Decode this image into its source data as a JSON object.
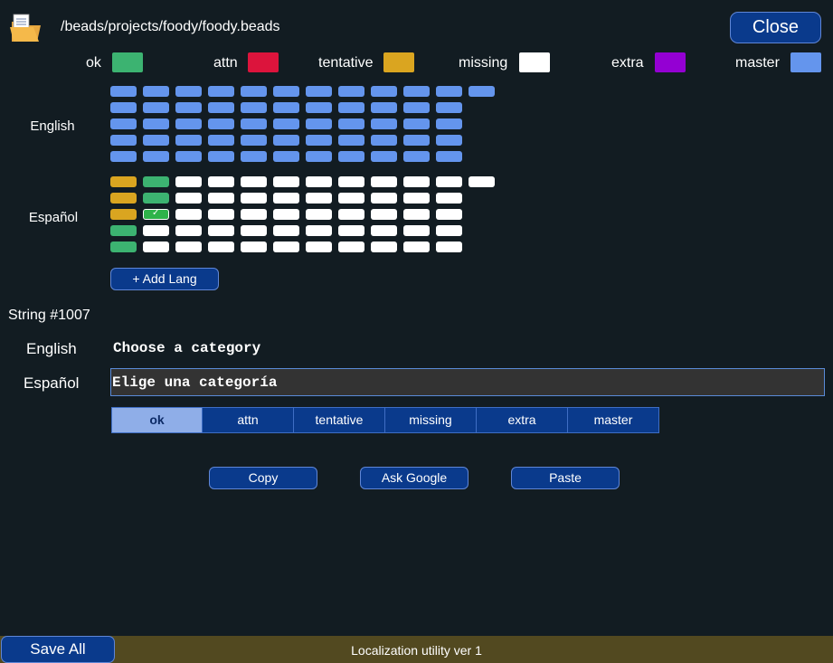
{
  "header": {
    "file_path": "/beads/projects/foody/foody.beads",
    "close_label": "Close",
    "folder_icon": "folder-document-icon"
  },
  "legend": [
    {
      "label": "ok",
      "color": "#3cb371"
    },
    {
      "label": "attn",
      "color": "#dc143c"
    },
    {
      "label": "tentative",
      "color": "#daa520"
    },
    {
      "label": "missing",
      "color": "#ffffff"
    },
    {
      "label": "extra",
      "color": "#9400d3"
    },
    {
      "label": "master",
      "color": "#6495ed"
    }
  ],
  "languages": [
    {
      "name": "English",
      "rows": [
        [
          "master",
          "master",
          "master",
          "master",
          "master",
          "master",
          "master",
          "master",
          "master",
          "master",
          "master",
          "master"
        ],
        [
          "master",
          "master",
          "master",
          "master",
          "master",
          "master",
          "master",
          "master",
          "master",
          "master",
          "master"
        ],
        [
          "master",
          "master",
          "master",
          "master",
          "master",
          "master",
          "master",
          "master",
          "master",
          "master",
          "master"
        ],
        [
          "master",
          "master",
          "master",
          "master",
          "master",
          "master",
          "master",
          "master",
          "master",
          "master",
          "master"
        ],
        [
          "master",
          "master",
          "master",
          "master",
          "master",
          "master",
          "master",
          "master",
          "master",
          "master",
          "master"
        ]
      ]
    },
    {
      "name": "Español",
      "rows": [
        [
          "tentative",
          "ok",
          "missing",
          "missing",
          "missing",
          "missing",
          "missing",
          "missing",
          "missing",
          "missing",
          "missing",
          "missing"
        ],
        [
          "tentative",
          "ok",
          "missing",
          "missing",
          "missing",
          "missing",
          "missing",
          "missing",
          "missing",
          "missing",
          "missing"
        ],
        [
          "tentative",
          "ok-selected",
          "missing",
          "missing",
          "missing",
          "missing",
          "missing",
          "missing",
          "missing",
          "missing",
          "missing"
        ],
        [
          "ok",
          "missing",
          "missing",
          "missing",
          "missing",
          "missing",
          "missing",
          "missing",
          "missing",
          "missing",
          "missing"
        ],
        [
          "ok",
          "missing",
          "missing",
          "missing",
          "missing",
          "missing",
          "missing",
          "missing",
          "missing",
          "missing",
          "missing"
        ]
      ]
    }
  ],
  "selected_cell_icon": "check-icon",
  "add_lang_label": "+ Add Lang",
  "editor": {
    "string_number": "String #1007",
    "english_label": "English",
    "english_text": "Choose a category",
    "translation_label": "Español",
    "translation_value": "Elige una categoría"
  },
  "status_tabs": [
    {
      "label": "ok",
      "selected": true
    },
    {
      "label": "attn",
      "selected": false
    },
    {
      "label": "tentative",
      "selected": false
    },
    {
      "label": "missing",
      "selected": false
    },
    {
      "label": "extra",
      "selected": false
    },
    {
      "label": "master",
      "selected": false
    }
  ],
  "actions": {
    "copy_label": "Copy",
    "ask_google_label": "Ask Google",
    "paste_label": "Paste"
  },
  "footer": {
    "save_all_label": "Save All",
    "version_text": "Localization utility ver 1"
  }
}
